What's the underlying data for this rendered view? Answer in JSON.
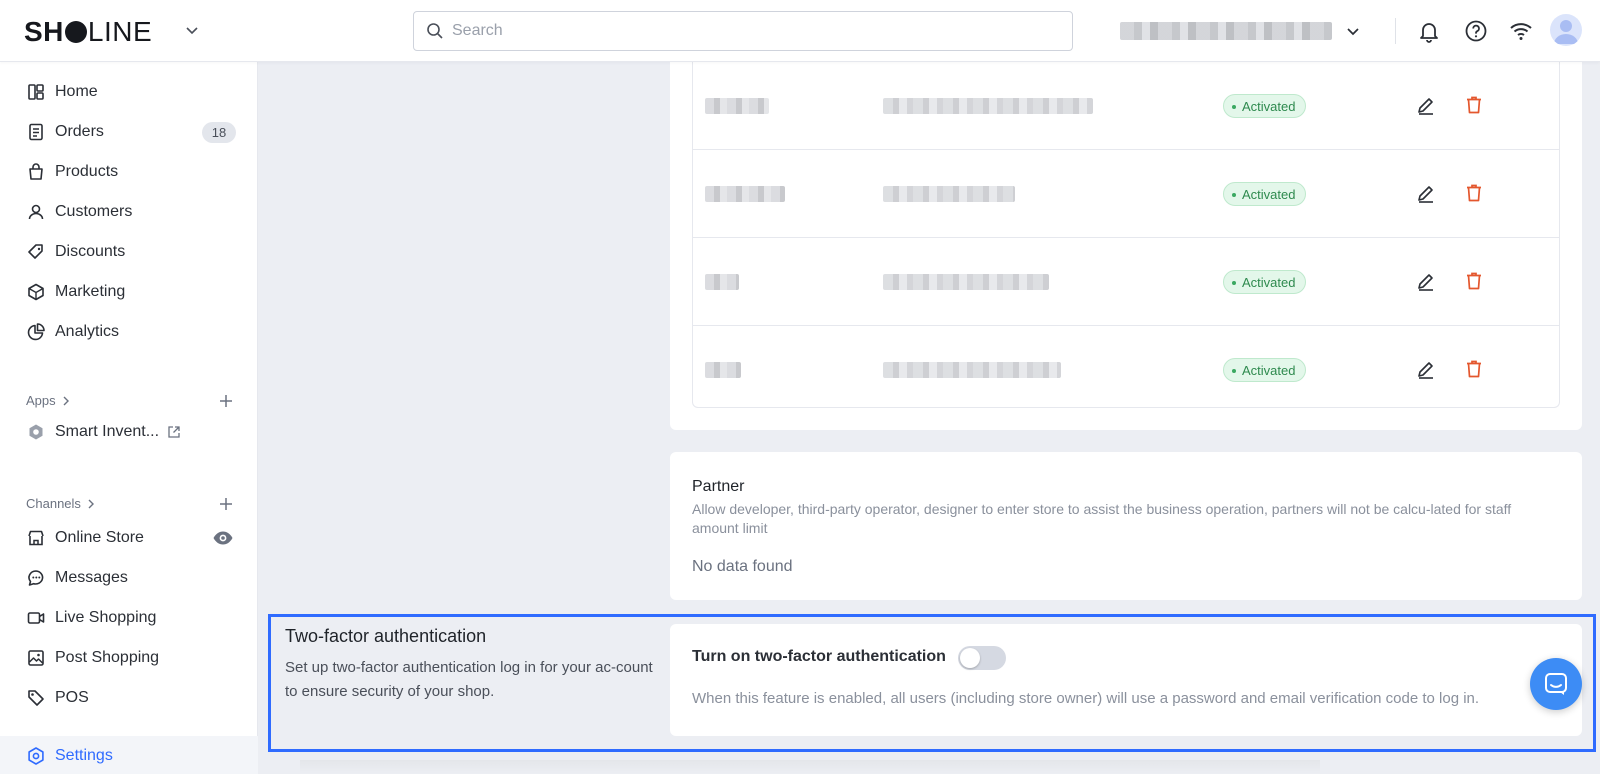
{
  "header": {
    "logo": {
      "part1": "SH",
      "part2": "P",
      "part3": "LINE"
    },
    "search_placeholder": "Search"
  },
  "sidebar": {
    "items": [
      {
        "label": "Home",
        "icon": "home-icon"
      },
      {
        "label": "Orders",
        "icon": "orders-icon",
        "badge": "18"
      },
      {
        "label": "Products",
        "icon": "products-icon"
      },
      {
        "label": "Customers",
        "icon": "customers-icon"
      },
      {
        "label": "Discounts",
        "icon": "discounts-icon"
      },
      {
        "label": "Marketing",
        "icon": "marketing-icon"
      },
      {
        "label": "Analytics",
        "icon": "analytics-icon"
      }
    ],
    "apps_label": "Apps",
    "apps": [
      {
        "label": "Smart Invent...",
        "icon": "smart-inventory-icon"
      }
    ],
    "channels_label": "Channels",
    "channels": [
      {
        "label": "Online Store",
        "icon": "online-store-icon"
      },
      {
        "label": "Messages",
        "icon": "messages-icon"
      },
      {
        "label": "Live Shopping",
        "icon": "live-shopping-icon"
      },
      {
        "label": "Post Shopping",
        "icon": "post-shopping-icon"
      },
      {
        "label": "POS",
        "icon": "pos-icon"
      }
    ],
    "settings_label": "Settings"
  },
  "staff": {
    "rows": [
      {
        "status": "Activated"
      },
      {
        "status": "Activated"
      },
      {
        "status": "Activated"
      },
      {
        "status": "Activated"
      }
    ]
  },
  "partner": {
    "title": "Partner",
    "description": "Allow developer, third-party operator, designer to enter store to assist the business operation, partners will not be calcu-lated for staff amount limit",
    "empty": "No data found"
  },
  "two_factor": {
    "title": "Two-factor authentication",
    "description": "Set up two-factor authentication log in for your ac-count to ensure security of your shop.",
    "toggle_label": "Turn on two-factor authentication",
    "toggle_on": false,
    "note": "When this feature is enabled, all users (including store owner) will use a password and email verification code to log in."
  },
  "colors": {
    "accent": "#2f6bff",
    "activated": "#2e8a4e",
    "delete": "#e4572e"
  }
}
